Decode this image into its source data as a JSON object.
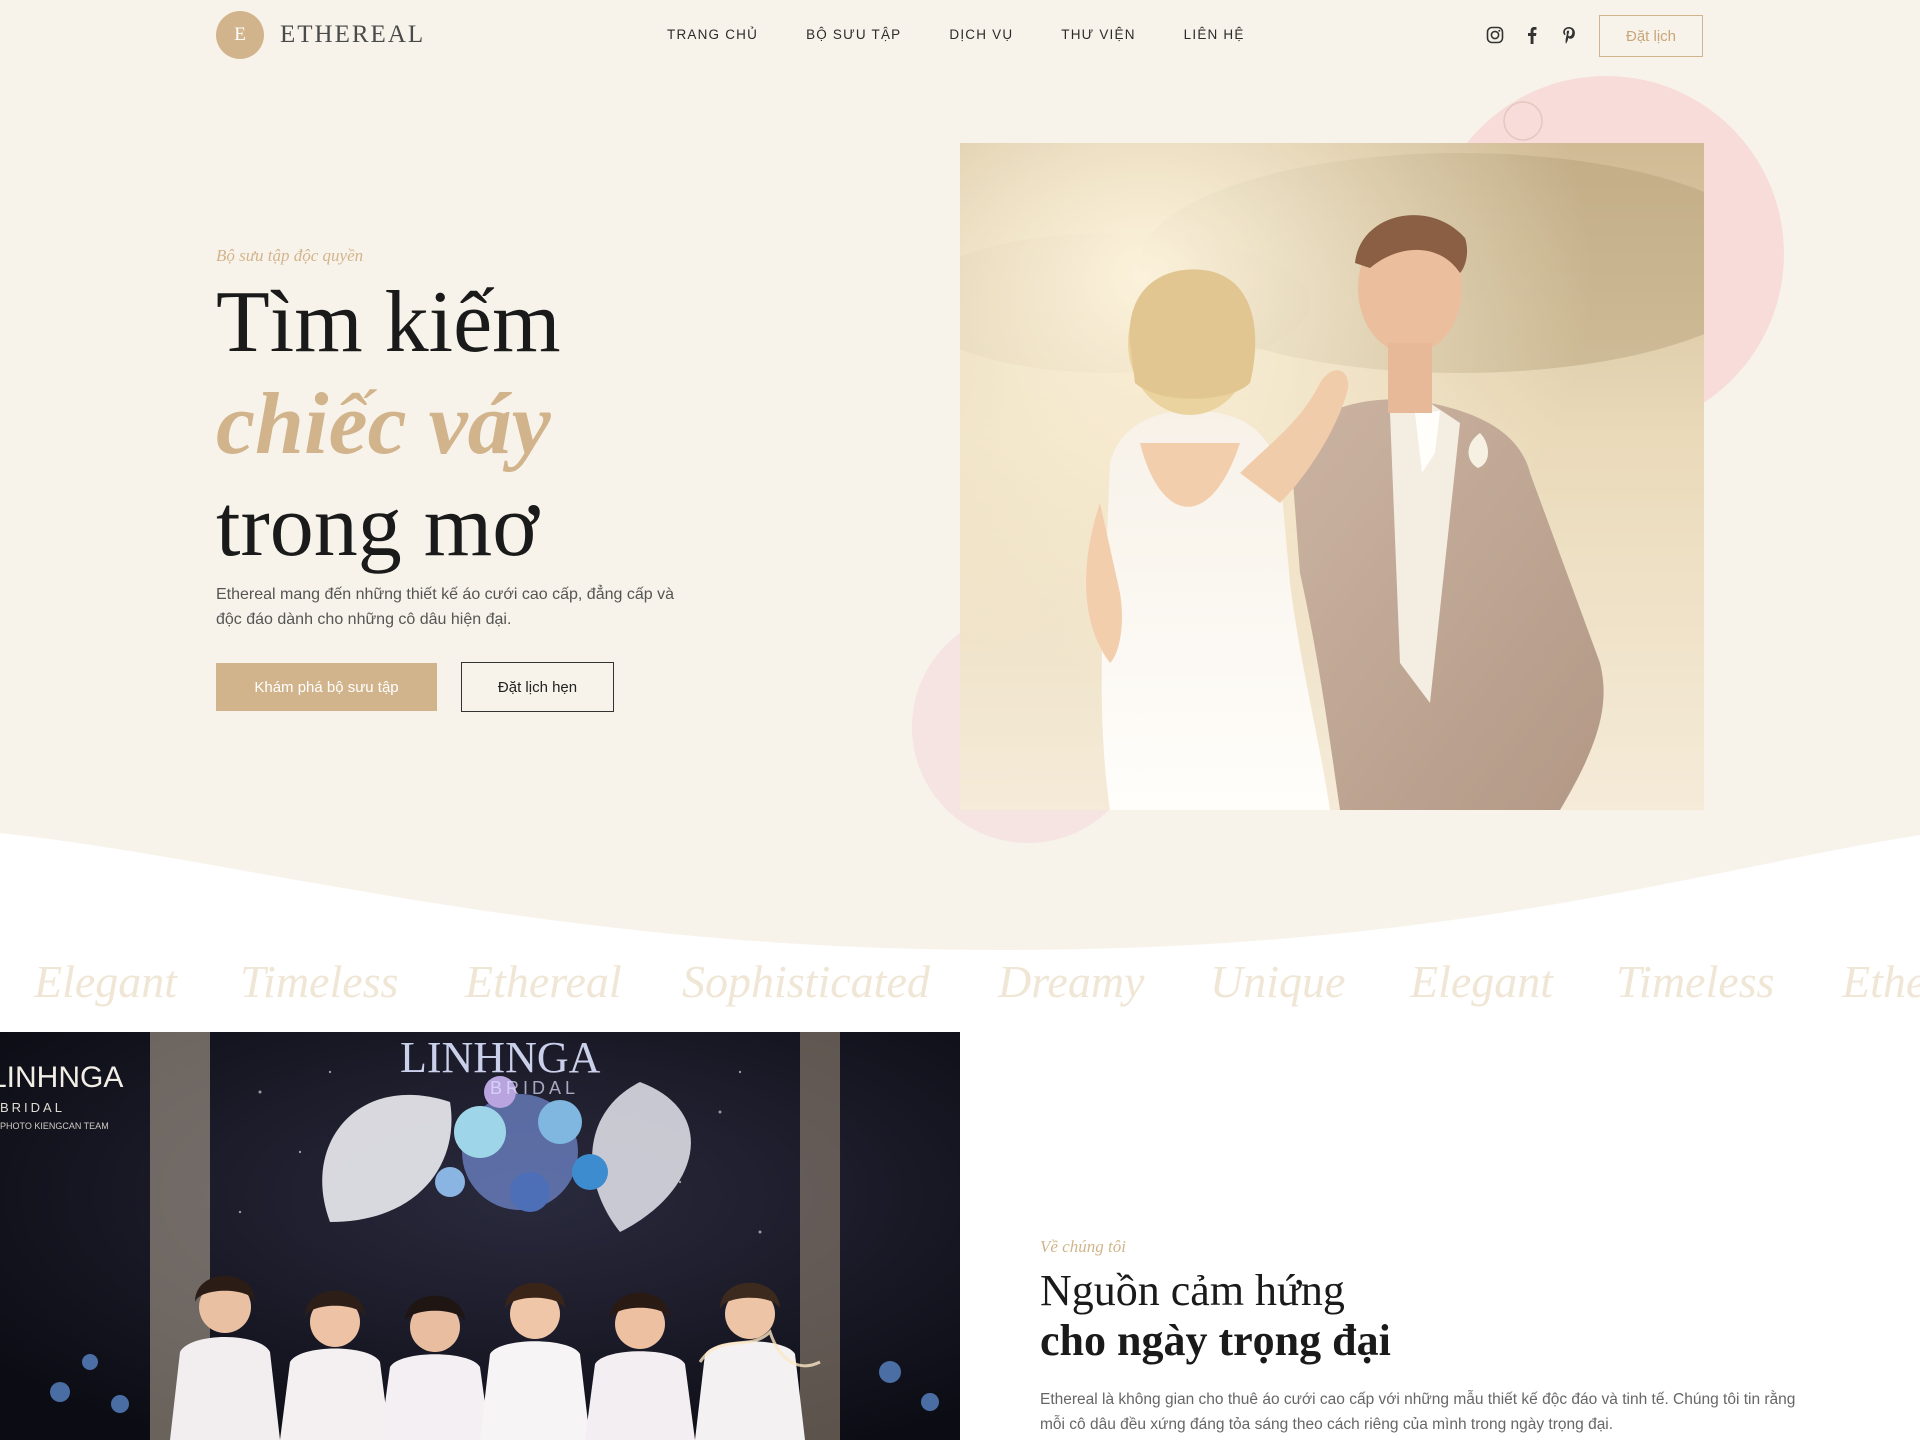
{
  "brand": {
    "logo_letter": "E",
    "name": "ETHEREAL"
  },
  "nav": {
    "items": [
      "TRANG CHỦ",
      "BỘ SƯU TẬP",
      "DỊCH VỤ",
      "THƯ VIỆN",
      "LIÊN HỆ"
    ]
  },
  "social": {
    "icons": [
      "instagram-icon",
      "facebook-icon",
      "pinterest-icon"
    ]
  },
  "header": {
    "book_label": "Đặt lịch"
  },
  "hero": {
    "eyebrow": "Bộ sưu tập độc quyền",
    "title_line1": "Tìm kiếm",
    "title_line2": "chiếc váy",
    "title_line3": "trong mơ",
    "description": "Ethereal mang đến những thiết kế áo cưới cao cấp, đẳng cấp và độc đáo dành cho những cô dâu hiện đại.",
    "primary_button": "Khám phá bộ sưu tập",
    "secondary_button": "Đặt lịch hẹn"
  },
  "marquee": {
    "words": [
      "Elegant",
      "Timeless",
      "Ethereal",
      "Sophisticated",
      "Dreamy",
      "Unique",
      "Elegant",
      "Timeless",
      "Ethereal"
    ]
  },
  "about": {
    "eyebrow": "Về chúng tôi",
    "title_line1": "Nguồn cảm hứng",
    "title_line2": "cho ngày trọng đại",
    "description": "Ethereal là không gian cho thuê áo cưới cao cấp với những mẫu thiết kế độc đáo và tinh tế. Chúng tôi tin rằng mỗi cô dâu đều xứng đáng tỏa sáng theo cách riêng của mình trong ngày trọng đại.",
    "photo_sign_text": "LINHNGA",
    "photo_sign_sub": "BRIDAL",
    "photo_sign_credit": "PHOTO KIENGCAN TEAM"
  },
  "colors": {
    "cream": "#f8f3ea",
    "gold": "#d2b48c",
    "blush": "#f5dcd8",
    "marquee_text": "#f0e6d6"
  }
}
